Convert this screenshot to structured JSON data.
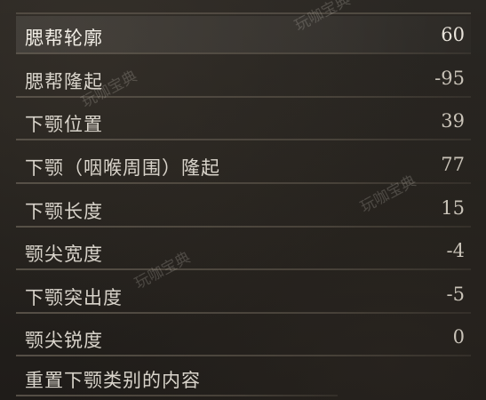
{
  "menu": {
    "items": [
      {
        "label": "腮帮轮廓",
        "value": "60",
        "selected": true
      },
      {
        "label": "腮帮隆起",
        "value": "-95"
      },
      {
        "label": "下颚位置",
        "value": "39"
      },
      {
        "label": "下颚（咽喉周围）隆起",
        "value": "77"
      },
      {
        "label": "下颚长度",
        "value": "15"
      },
      {
        "label": "颚尖宽度",
        "value": "-4"
      },
      {
        "label": "下颚突出度",
        "value": "-5"
      },
      {
        "label": "颚尖锐度",
        "value": "0"
      }
    ],
    "reset_label": "重置下颚类别的内容"
  },
  "watermark": {
    "text": "玩咖宝典"
  },
  "colors": {
    "background": "#24211d",
    "text": "#d9d4cb",
    "divider": "#5f584e"
  }
}
